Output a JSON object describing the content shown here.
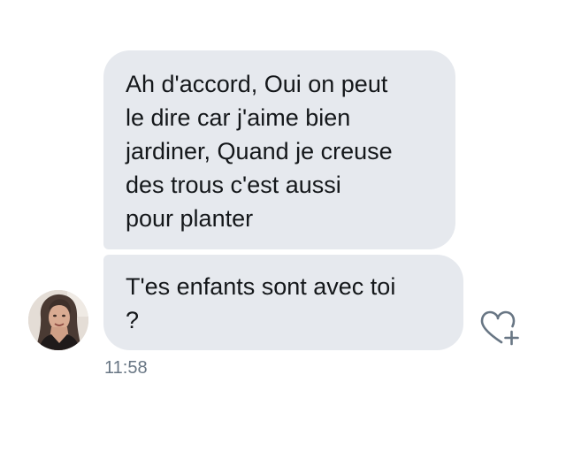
{
  "conversation": {
    "messages": [
      {
        "lines": [
          "Ah d'accord, Oui on peut",
          "le dire car j'aime bien",
          "jardiner, Quand je creuse",
          "des trous c'est aussi",
          "pour planter"
        ]
      },
      {
        "lines": [
          "T'es enfants sont avec toi",
          "?"
        ]
      }
    ],
    "timestamp": "11:58"
  },
  "icons": {
    "avatar": "profile-photo",
    "reaction": "heart-plus-icon"
  },
  "colors": {
    "bubble_background": "#e6e9ee",
    "message_text": "#14171a",
    "timestamp_text": "#687684",
    "icon_stroke": "#687684"
  }
}
